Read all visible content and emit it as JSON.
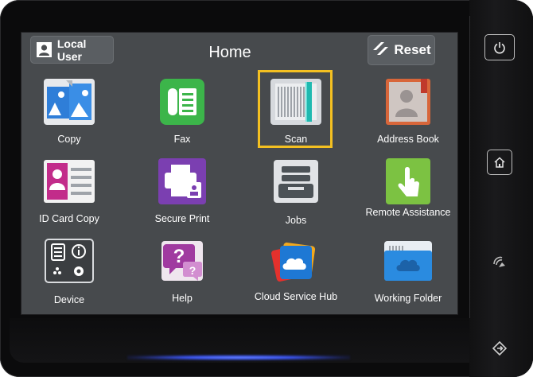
{
  "header": {
    "user_label": "Local User",
    "title": "Home",
    "reset_label": "Reset"
  },
  "apps": [
    {
      "label": "Copy",
      "icon": "copy-icon"
    },
    {
      "label": "Fax",
      "icon": "fax-icon"
    },
    {
      "label": "Scan",
      "icon": "scan-icon",
      "selected": true
    },
    {
      "label": "Address Book",
      "icon": "address-book-icon"
    },
    {
      "label": "ID Card Copy",
      "icon": "id-card-icon"
    },
    {
      "label": "Secure Print",
      "icon": "secure-print-icon"
    },
    {
      "label": "Jobs",
      "icon": "jobs-icon"
    },
    {
      "label": "Remote Assistance",
      "icon": "remote-assistance-icon"
    },
    {
      "label": "Device",
      "icon": "device-icon"
    },
    {
      "label": "Help",
      "icon": "help-icon"
    },
    {
      "label": "Cloud Service Hub",
      "icon": "cloud-service-hub-icon"
    },
    {
      "label": "Working Folder",
      "icon": "working-folder-icon"
    }
  ],
  "hardware": {
    "power": "power-icon",
    "home": "home-icon",
    "nfc": "nfc-icon",
    "nav": "navigation-icon"
  },
  "colors": {
    "screen_bg": "#474a4d",
    "selection": "#f4c021",
    "fax_green": "#3cb54a",
    "secure_print_purple": "#7b3fb1",
    "remote_assist_green": "#7cc242",
    "id_card_magenta": "#c22c8a"
  }
}
